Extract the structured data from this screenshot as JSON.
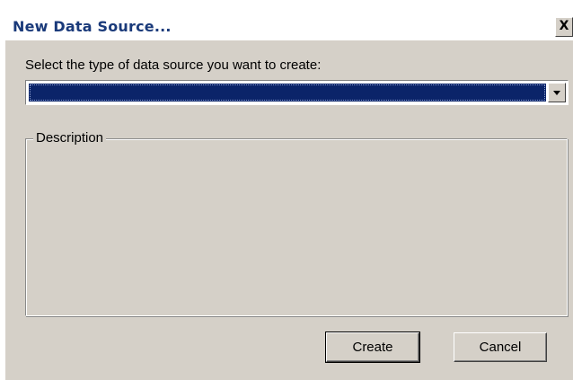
{
  "window": {
    "title": "New Data Source...",
    "close_glyph": "X"
  },
  "form": {
    "prompt": "Select the type of data source you want to create:",
    "data_source_type_value": "",
    "dropdown_icon": "chevron-down-icon"
  },
  "description_group": {
    "label": "Description",
    "text": ""
  },
  "buttons": {
    "create_label": "Create",
    "cancel_label": "Cancel"
  },
  "colors": {
    "title_text": "#1a3a7a",
    "dialog_face": "#d5d0c8",
    "selection_highlight": "#0b2469"
  }
}
